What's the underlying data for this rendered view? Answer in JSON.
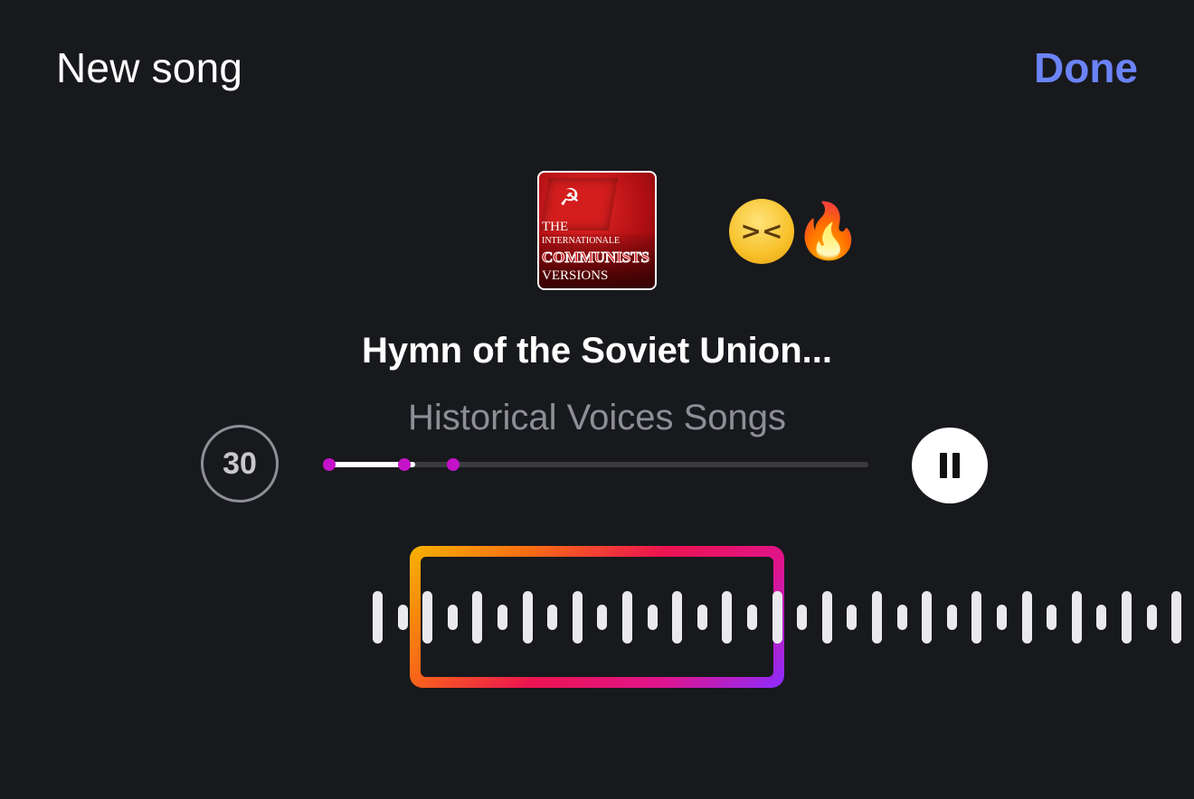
{
  "header": {
    "title": "New song",
    "done_label": "Done"
  },
  "song": {
    "cover": {
      "line1": "THE",
      "line2": "INTERNATIONALE",
      "line3": "COMMUNISTS",
      "line4": "VERSIONS"
    },
    "title": "Hymn of the Soviet Union...",
    "artist": "Historical Voices Songs"
  },
  "reactions": {
    "emoji_1": "laughing-face",
    "emoji_2": "fire",
    "emoji_2_char": "🔥"
  },
  "player": {
    "duration": "30",
    "progress_fraction": 0.16,
    "markers_fraction": [
      0.0,
      0.14,
      0.23
    ],
    "state": "playing"
  },
  "colors": {
    "accent": "#6b83f6",
    "marker": "#c412c8",
    "background": "#18191d"
  }
}
